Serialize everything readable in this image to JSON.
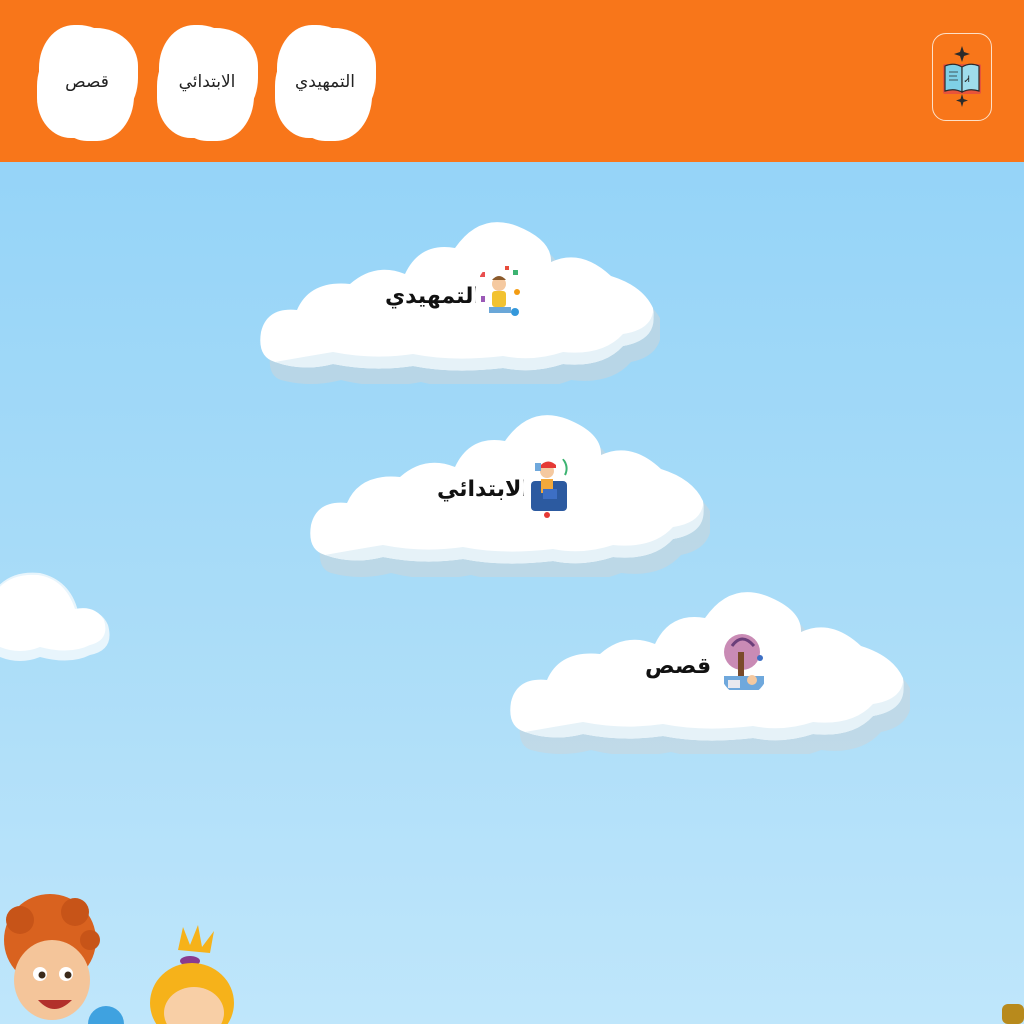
{
  "header": {
    "logo_icon": "book-logo-icon",
    "nav": [
      {
        "label": "التمهيدي"
      },
      {
        "label": "الابتدائي"
      },
      {
        "label": "قصص"
      }
    ]
  },
  "cards": [
    {
      "label": "التمهيدي",
      "icon": "child-studying-icon"
    },
    {
      "label": "الابتدائي",
      "icon": "child-reading-icon"
    },
    {
      "label": "قصص",
      "icon": "storybook-icon"
    }
  ],
  "colors": {
    "header": "#f8761a",
    "sky_top": "#95d4f8",
    "sky_bottom": "#bfe6fb",
    "cloud": "#ffffff"
  }
}
